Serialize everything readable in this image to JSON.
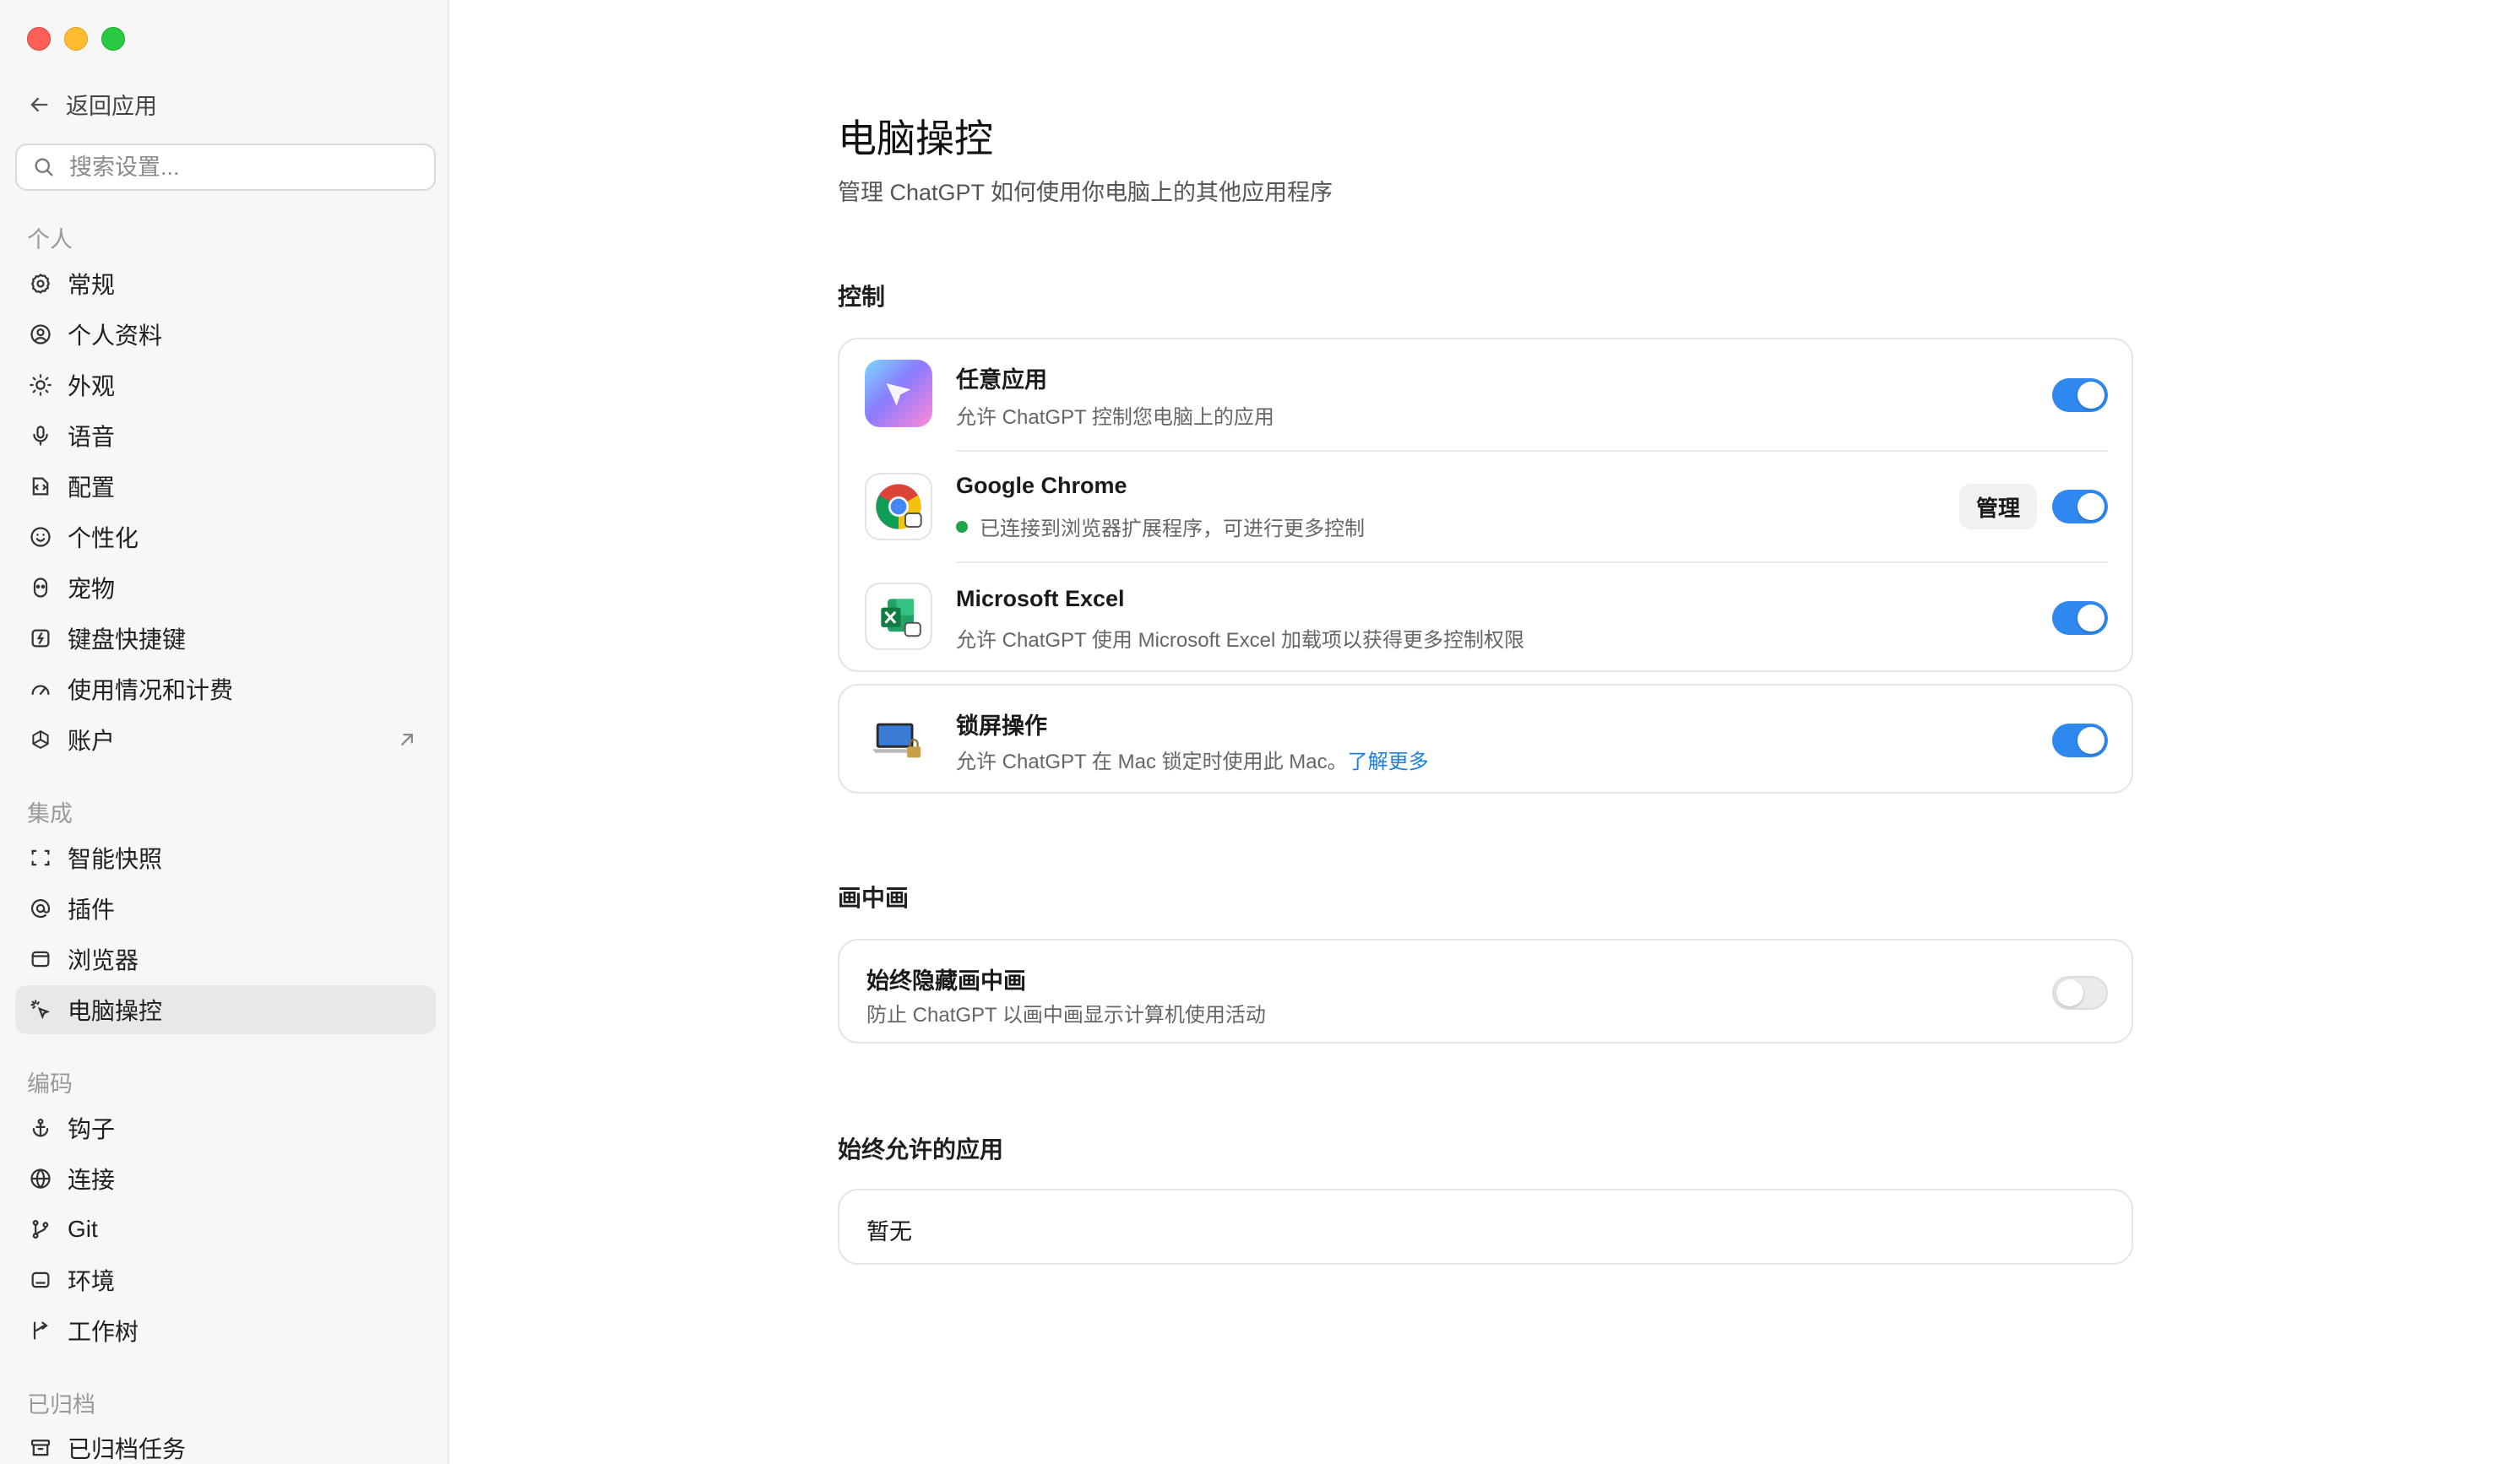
{
  "sidebar": {
    "back_label": "返回应用",
    "search_placeholder": "搜索设置...",
    "sections": {
      "personal": "个人",
      "integrations": "集成",
      "coding": "编码",
      "archived": "已归档"
    },
    "items": {
      "general": "常规",
      "profile": "个人资料",
      "appearance": "外观",
      "voice": "语音",
      "config": "配置",
      "personalization": "个性化",
      "pets": "宠物",
      "shortcuts": "键盘快捷键",
      "usage": "使用情况和计费",
      "account": "账户",
      "smart_snapshot": "智能快照",
      "plugins": "插件",
      "browser": "浏览器",
      "computer_control": "电脑操控",
      "hooks": "钩子",
      "connections": "连接",
      "git": "Git",
      "environment": "环境",
      "worktree": "工作树",
      "archived_tasks": "已归档任务"
    }
  },
  "main": {
    "title": "电脑操控",
    "subtitle": "管理 ChatGPT 如何使用你电脑上的其他应用程序",
    "control": {
      "heading": "控制",
      "any_app": {
        "title": "任意应用",
        "desc": "允许 ChatGPT 控制您电脑上的应用",
        "enabled": true
      },
      "chrome": {
        "title": "Google Chrome",
        "desc": "已连接到浏览器扩展程序，可进行更多控制",
        "manage": "管理",
        "enabled": true
      },
      "excel": {
        "title": "Microsoft Excel",
        "desc": "允许 ChatGPT 使用 Microsoft Excel 加载项以获得更多控制权限",
        "enabled": true
      },
      "lock_screen": {
        "title": "锁屏操作",
        "desc": "允许 ChatGPT 在 Mac 锁定时使用此 Mac。",
        "link": "了解更多",
        "enabled": true
      }
    },
    "pip": {
      "heading": "画中画",
      "hide": {
        "title": "始终隐藏画中画",
        "desc": "防止 ChatGPT 以画中画显示计算机使用活动",
        "enabled": false
      }
    },
    "allowed_apps": {
      "heading": "始终允许的应用",
      "empty": "暂无"
    }
  },
  "colors": {
    "accent": "#2f88f0",
    "link": "#1a7fe0",
    "status_connected": "#1fa64a"
  }
}
